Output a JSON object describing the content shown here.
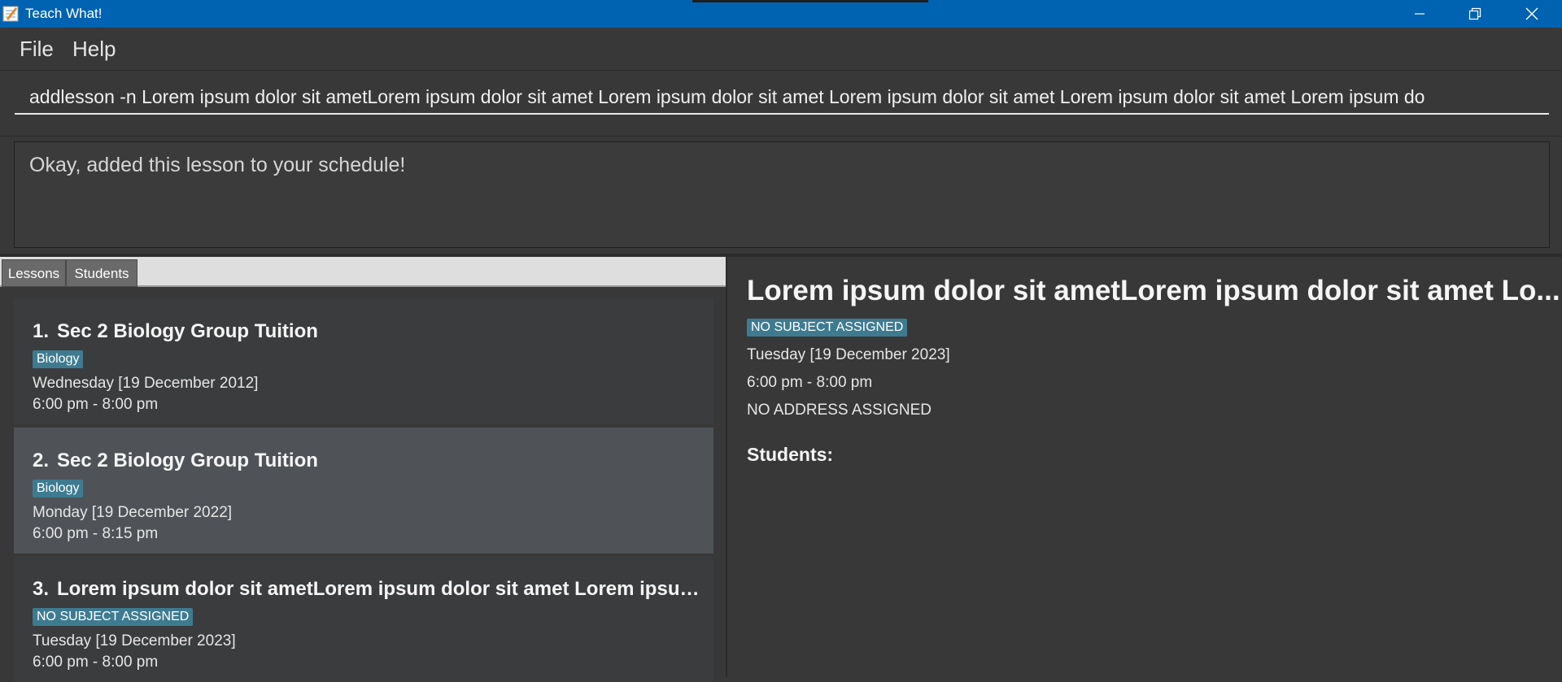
{
  "window": {
    "title": "Teach What!"
  },
  "menu": {
    "file": "File",
    "help": "Help"
  },
  "command": {
    "value": "addlesson -n Lorem ipsum dolor sit ametLorem ipsum dolor sit amet Lorem ipsum dolor sit amet Lorem ipsum dolor sit amet Lorem ipsum dolor sit amet Lorem ipsum do"
  },
  "result": {
    "message": "Okay, added this lesson to your schedule!"
  },
  "tabs": {
    "lessons": "Lessons",
    "students": "Students"
  },
  "lessons": [
    {
      "index": "1.",
      "name": "Sec 2 Biology Group Tuition",
      "subject": "Biology",
      "date": "Wednesday [19 December 2012]",
      "time": "6:00 pm - 8:00 pm"
    },
    {
      "index": "2.",
      "name": "Sec 2 Biology Group Tuition",
      "subject": "Biology",
      "date": "Monday [19 December 2022]",
      "time": "6:00 pm - 8:15 pm"
    },
    {
      "index": "3.",
      "name": "Lorem ipsum dolor sit ametLorem ipsum dolor sit amet Lorem ipsum d...",
      "subject": "NO SUBJECT ASSIGNED",
      "date": "Tuesday [19 December 2023]",
      "time": "6:00 pm - 8:00 pm"
    }
  ],
  "detail": {
    "title": "Lorem ipsum dolor sit ametLorem ipsum dolor sit amet Lo...",
    "subject": "NO SUBJECT ASSIGNED",
    "date": "Tuesday [19 December 2023]",
    "time": "6:00 pm - 8:00 pm",
    "address": "NO ADDRESS ASSIGNED",
    "students_label": "Students:"
  },
  "colors": {
    "titlebar": "#0063b1",
    "background": "#383838",
    "tag": "#3e7b91",
    "selected_card": "#4f5357"
  }
}
